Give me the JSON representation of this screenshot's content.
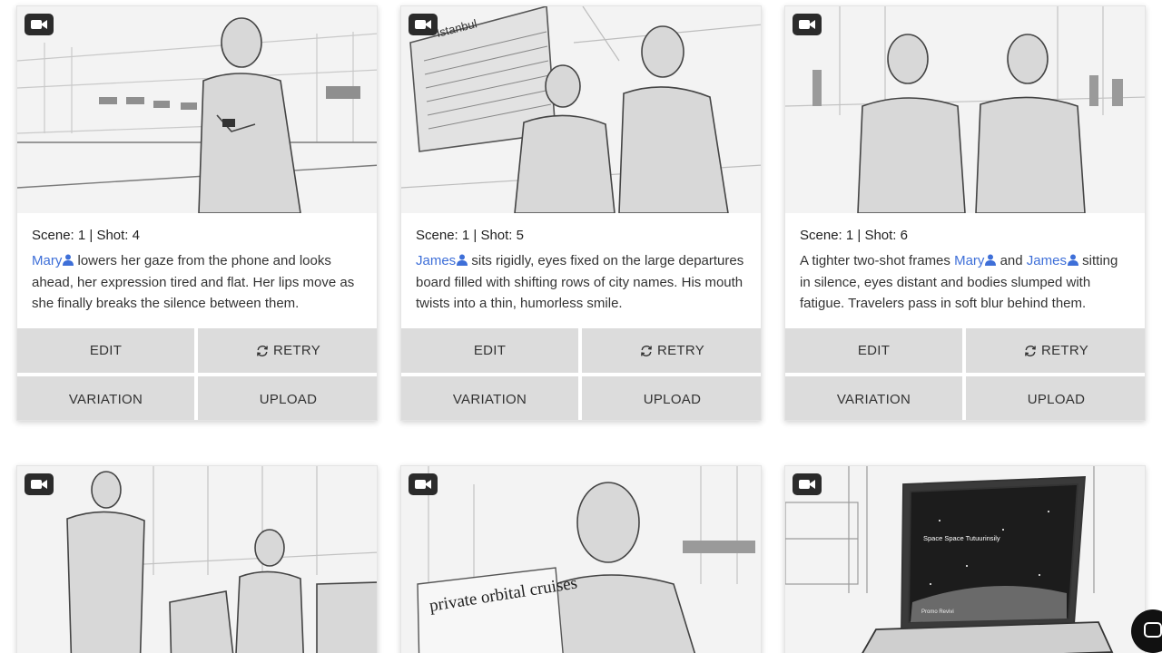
{
  "buttons": {
    "edit": "EDIT",
    "retry": "RETRY",
    "variation": "VARIATION",
    "upload": "UPLOAD"
  },
  "cards": [
    {
      "scene_shot": "Scene: 1 | Shot: 4",
      "characters": [
        "Mary"
      ],
      "text_1": " lowers her gaze from the phone and looks ahead, her expression tired and flat. Her lips move as she finally breaks the silence between them.",
      "image": "woman looking at phone in airport terminal sketch"
    },
    {
      "scene_shot": "Scene: 1 | Shot: 5",
      "characters": [
        "James"
      ],
      "text_1": " sits rigidly, eyes fixed on the large departures board filled with shifting rows of city names. His mouth twists into a thin, humorless smile.",
      "image": "two travelers seated beneath departures board sketch",
      "board_text": "Istanbul"
    },
    {
      "scene_shot": "Scene: 1 | Shot: 6",
      "characters": [
        "Mary",
        "James"
      ],
      "text_1": "A tighter two-shot frames ",
      "text_2": " and ",
      "text_3": " sitting in silence, eyes distant and bodies slumped with fatigue. Travelers pass in soft blur behind them.",
      "image": "two-shot of seated tired travelers sketch"
    },
    {
      "image": "man walking past woman seated in terminal sketch"
    },
    {
      "image": "smiling woman reading newspaper sketch",
      "newspaper_headline": "private orbital cruises"
    },
    {
      "image": "laptop showing space tourism website sketch",
      "screen_title": "Space Space Tutuurinsily",
      "screen_caption": "Promo Revivi"
    }
  ],
  "colors": {
    "character_link": "#3e6fd8",
    "button_bg": "#dcdcdc",
    "badge_bg": "#2b2b2b"
  }
}
